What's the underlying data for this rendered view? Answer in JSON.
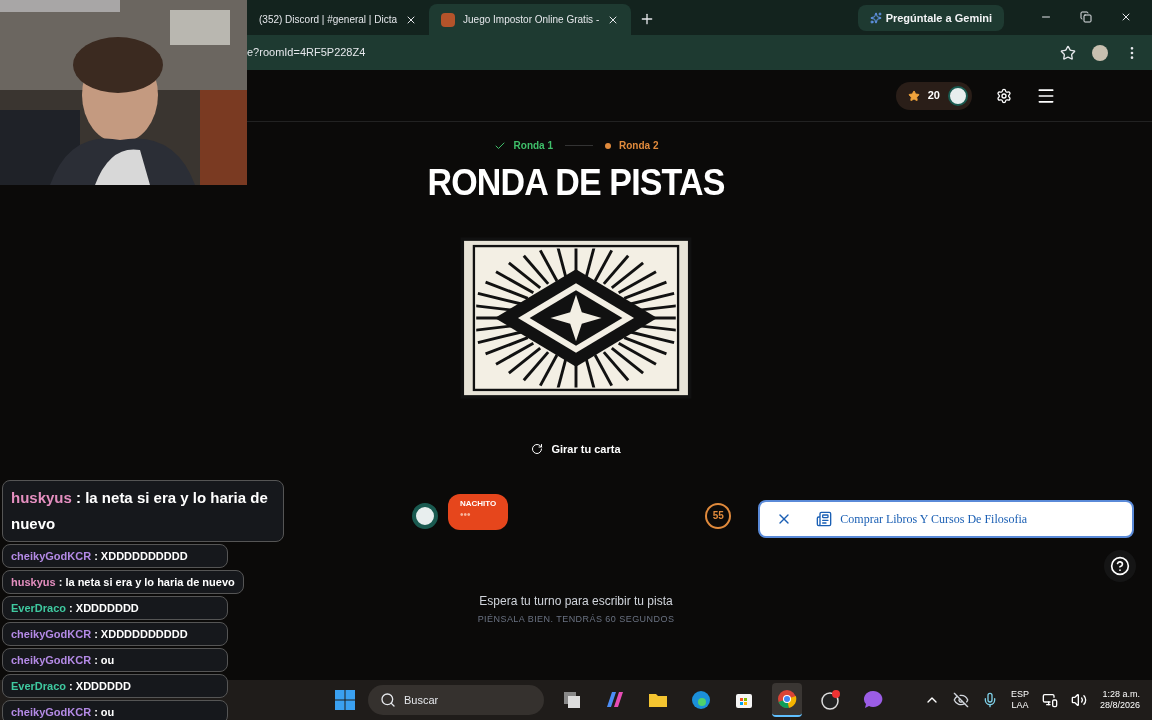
{
  "browser": {
    "tabs": [
      {
        "title": "(352) Discord | #general | Dicta",
        "selected": false
      },
      {
        "title": "Juego Impostor Online Gratis -",
        "selected": true
      }
    ],
    "gemini_button": "Pregúntale a Gemini",
    "address": "e?roomId=4RF5P228Z4"
  },
  "header": {
    "points": "20"
  },
  "rounds": [
    {
      "label": "Ronda 1",
      "completed": true
    },
    {
      "label": "Ronda 2",
      "completed": false
    }
  ],
  "title": "RONDA DE PISTAS",
  "flip_button": "Girar tu carta",
  "player": {
    "name": "NACHITO",
    "bubble": "•••"
  },
  "timer": "55",
  "ad": {
    "text": "Comprar Libros Y Cursos De Filosofia"
  },
  "status": {
    "message": "Espera tu turno para escribir tu pista",
    "hint": "PIÉNSALA BIEN. TENDRÁS 60 SEGUNDOS"
  },
  "chat": [
    {
      "user": "huskyus",
      "text": ": la neta si era y lo haria de nuevo",
      "color": "#e58fc0",
      "kind": "large"
    },
    {
      "user": "cheikyGodKCR",
      "text": ": XDDDDDDDDDD",
      "color": "#b48ae6",
      "kind": "small"
    },
    {
      "user": "huskyus",
      "text": ": la neta si era y lo haria de nuevo",
      "color": "#e58fc0",
      "kind": "small"
    },
    {
      "user": "EverDraco",
      "text": ": XDDDDDDD",
      "color": "#3fc9a0",
      "kind": "small"
    },
    {
      "user": "cheikyGodKCR",
      "text": ": XDDDDDDDDDD",
      "color": "#b48ae6",
      "kind": "small"
    },
    {
      "user": "cheikyGodKCR",
      "text": ": ou",
      "color": "#b48ae6",
      "kind": "small"
    },
    {
      "user": "EverDraco",
      "text": ": XDDDDDD",
      "color": "#3fc9a0",
      "kind": "small"
    },
    {
      "user": "cheikyGodKCR",
      "text": ": ou",
      "color": "#b48ae6",
      "kind": "small"
    }
  ],
  "taskbar": {
    "search": "Buscar",
    "apps": [
      {
        "kind": "taskview",
        "active": false
      },
      {
        "kind": "copilot",
        "active": false
      },
      {
        "kind": "files",
        "active": false
      },
      {
        "kind": "edge",
        "active": false
      },
      {
        "kind": "store",
        "active": false
      },
      {
        "kind": "chrome",
        "active": true
      },
      {
        "kind": "obs",
        "active": false
      },
      {
        "kind": "messenger",
        "active": false
      }
    ],
    "language": "ESP",
    "layout": "LAA",
    "time": "1:28 a.m.",
    "date": "28/8/2026"
  }
}
